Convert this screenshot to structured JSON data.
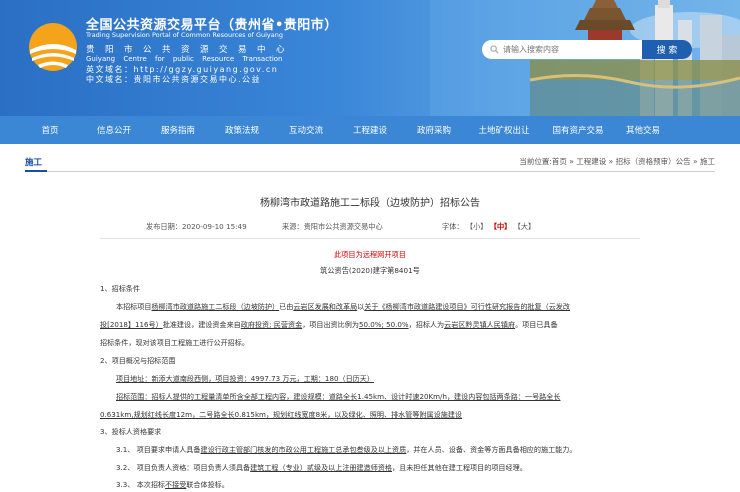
{
  "header": {
    "title": "全国公共资源交易平台（贵州省•贵阳市）",
    "subtitle": "Trading Supervision Portal of Common Resources of Guiyang",
    "center_cn": "贵阳市公共资源交易中心",
    "center_en": "Guiyang Centre for public Resource Transaction",
    "domain_en": "英文域名：http://ggzy.guiyang.gov.cn",
    "domain_cn": "中文域名：贵阳市公共资源交易中心.公益"
  },
  "search": {
    "placeholder": "请输入搜索内容",
    "button": "搜 索"
  },
  "nav": {
    "items": [
      "首页",
      "信息公开",
      "服务指南",
      "政策法规",
      "互动交流",
      "工程建设",
      "政府采购",
      "土地矿权出让",
      "国有资产交易",
      "其他交易"
    ]
  },
  "breadcrumb": {
    "current": "施工",
    "path": "当前位置:首页 » 工程建设 » 招标（资格预审）公告 » 施工"
  },
  "article": {
    "title": "杨柳湾市政道路施工二标段（边坡防护）招标公告",
    "publish": "发布日期：2020-09-10 15:49",
    "source": "来源：贵阳市公共资源交易中心",
    "font_label": "字体：",
    "font_small": "【小】",
    "font_mid": "【中】",
    "font_big": "【大】",
    "notice": "此项目为远程网开项目",
    "doc_no": "筑公资告(2020)建字第8401号",
    "s1_head": "1、招标条件",
    "s1_l1a": "本招标项目",
    "s1_l1b": "杨柳湾市政道路施工二标段（边坡防护）",
    "s1_l1c": "已由",
    "s1_l1d": "云岩区发展和改革局",
    "s1_l1e": "以",
    "s1_l1f": "关于《杨柳湾市政道路建设项目》可行性研究报告的批复（云发改",
    "s1_l2a": "投[2018】116号）",
    "s1_l2b": "批准建设，建设资金来自",
    "s1_l2c": "政府投资; 民营资金",
    "s1_l2d": "，项目出资比例为",
    "s1_l2e": "50.0%; 50.0%",
    "s1_l2f": "，招标人为",
    "s1_l2g": "云岩区黔灵镇人民镇府",
    "s1_l2h": "。项目已具备",
    "s1_l3": "招标条件，现对该项目工程施工进行公开招标。",
    "s2_head": "2、项目概况与招标范围",
    "s2_l1": "项目地址：新添大道南段西侧，项目投资：4997.73 万元，工期：180（日历天）",
    "s2_l2": "招标范围：招标人提供的工程量清单所含全部工程内容，建设规模：道路全长1.45km、设计时速20Km/h，建设内容包括两条路：一号路全长",
    "s2_l3": "0.631km,规划红线长度12m，二号路全长0.815km，规划红线宽度8米，以及绿化、照明、排水管等附属设施建设",
    "s3_head": "3、投标人资格要求",
    "s3_1a": "3.1、 项目要求申请人具备",
    "s3_1b": "建设行政主管部门核发的市政公用工程施工总承包叁级及以上资质",
    "s3_1c": "，并在人员、设备、资金等方面具备相应的施工能力。",
    "s3_2a": "3.2、 项目负责人资格：项目负责人须具备",
    "s3_2b": "建筑工程（专业）贰级及以上注册建造师资格",
    "s3_2c": "，且未担任其他在建工程项目的项目经理。",
    "s3_3a": "3.3、 本次招标",
    "s3_3b": "不接受",
    "s3_3c": "联合体投标。"
  },
  "colors": {
    "nav": "#3b87d6",
    "header_blue": "#2a6fc4",
    "link": "#1a4ea0",
    "red": "#dd0000"
  }
}
